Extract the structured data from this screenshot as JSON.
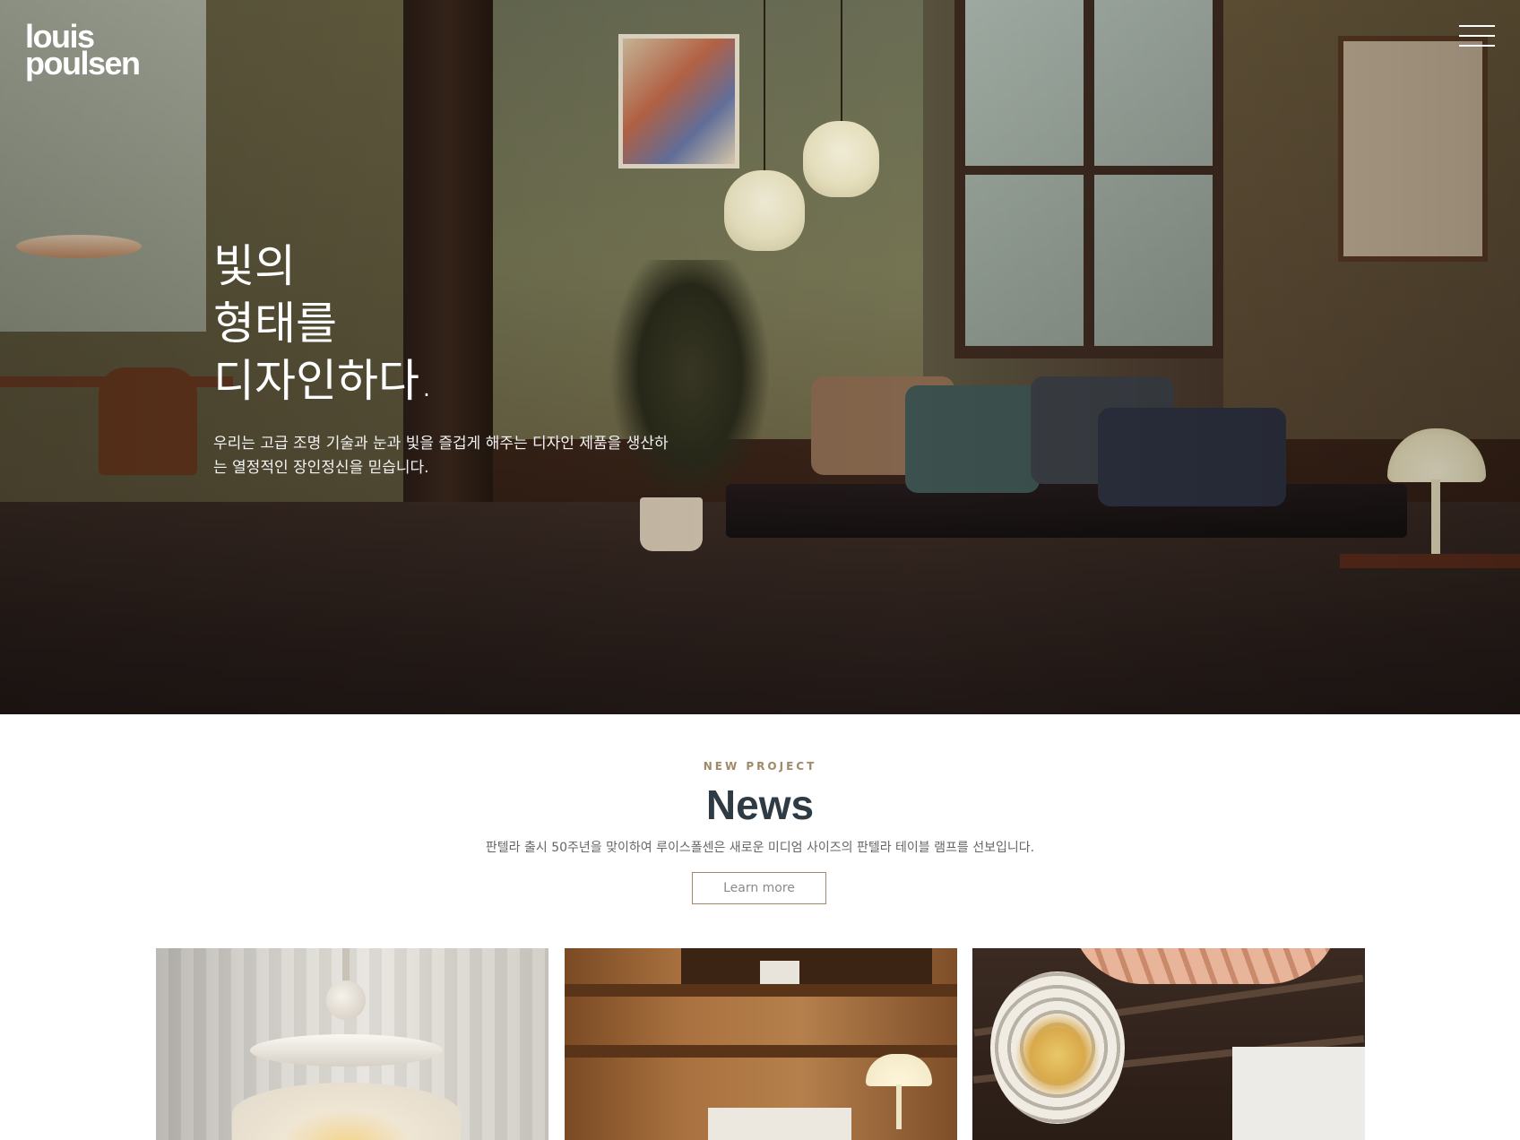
{
  "brand": {
    "logo_line1": "louis",
    "logo_line2": "poulsen"
  },
  "header": {
    "menu_icon": "hamburger-icon"
  },
  "hero": {
    "title_line1": "빛의",
    "title_line2": "형태를",
    "title_line3": "디자인하다.",
    "description": "우리는 고급 조명 기술과 눈과 빛을 즐겁게 해주는 디자인 제품을 생산하는 열정적인 장인정신을 믿습니다."
  },
  "news": {
    "eyebrow": "NEW PROJECT",
    "title": "News",
    "description": "판텔라 출시 50주년을 맞이하여 루이스폴센은 새로운 미디엄 사이즈의 판텔라 테이블 램프를 선보입니다.",
    "button_label": "Learn more"
  },
  "colors": {
    "accent": "#a08968",
    "heading": "#2f3b44",
    "body_text": "#666666"
  }
}
